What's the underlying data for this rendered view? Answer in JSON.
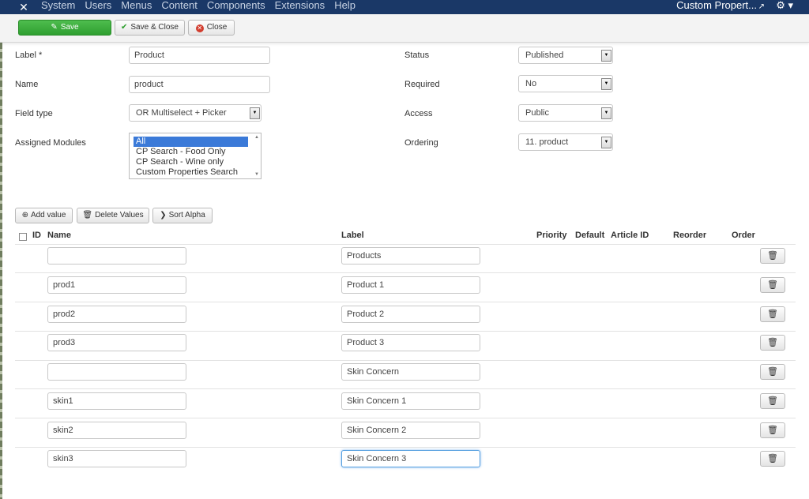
{
  "topnav": {
    "logo_icon": "joomla-logo",
    "menu": [
      "System",
      "Users",
      "Menus",
      "Content",
      "Components",
      "Extensions",
      "Help"
    ],
    "site_title": "Custom Propert...",
    "gear_icon": "⚙ ▾"
  },
  "toolbar": {
    "save": "Save",
    "save_close": "Save & Close",
    "close": "Close"
  },
  "form": {
    "label_label": "Label *",
    "label_value": "Product",
    "name_label": "Name",
    "name_value": "product",
    "fieldtype_label": "Field type",
    "fieldtype_value": "OR Multiselect + Picker",
    "modules_label": "Assigned Modules",
    "modules_options": [
      "All",
      "CP Search - Food Only",
      "CP Search - Wine only",
      "Custom Properties Search"
    ],
    "status_label": "Status",
    "status_value": "Published",
    "required_label": "Required",
    "required_value": "No",
    "access_label": "Access",
    "access_value": "Public",
    "ordering_label": "Ordering",
    "ordering_value": "11. product"
  },
  "values_toolbar": {
    "add": "Add value",
    "delete": "Delete Values",
    "sort": "Sort Alpha"
  },
  "table": {
    "headers": {
      "id": "ID",
      "name": "Name",
      "label": "Label",
      "priority": "Priority",
      "default": "Default",
      "article_id": "Article ID",
      "reorder": "Reorder",
      "order": "Order"
    },
    "rows": [
      {
        "name": "",
        "label": "Products"
      },
      {
        "name": "prod1",
        "label": "Product 1"
      },
      {
        "name": "prod2",
        "label": "Product 2"
      },
      {
        "name": "prod3",
        "label": "Product 3"
      },
      {
        "name": "",
        "label": "Skin Concern"
      },
      {
        "name": "skin1",
        "label": "Skin Concern 1"
      },
      {
        "name": "skin2",
        "label": "Skin Concern 2"
      },
      {
        "name": "skin3",
        "label": "Skin Concern 3"
      }
    ]
  },
  "colors": {
    "nav_bg": "#1a3867",
    "save_green": "#2f9f30",
    "close_red": "#d23c2d",
    "selected_blue": "#3b7ad8"
  }
}
